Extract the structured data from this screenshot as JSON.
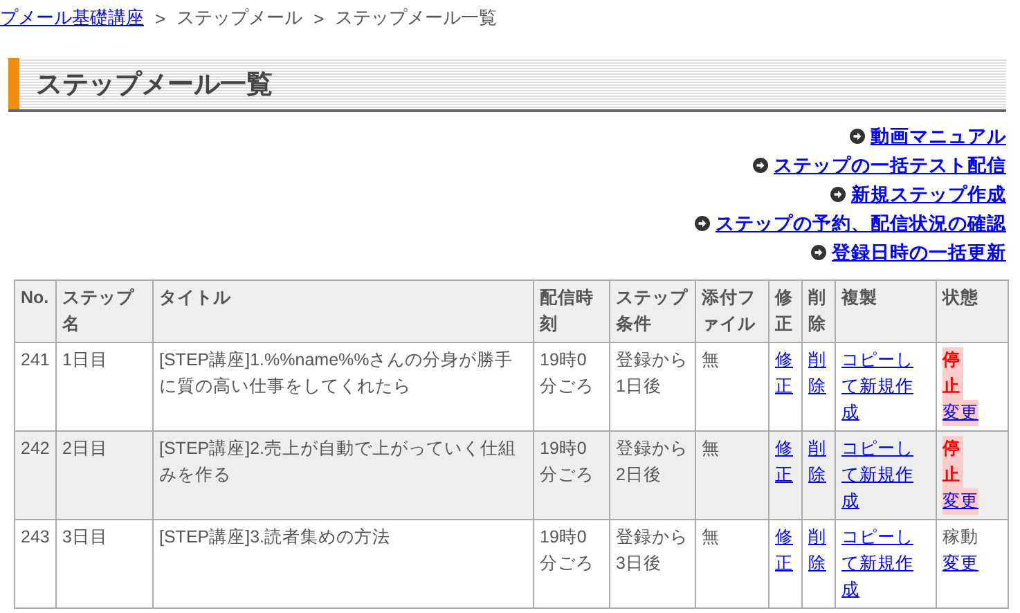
{
  "breadcrumb": [
    {
      "label": "プメール基礎講座",
      "link": true
    },
    {
      "label": "ステップメール",
      "link": false
    },
    {
      "label": "ステップメール一覧",
      "link": false
    }
  ],
  "breadcrumb_separator": ">",
  "heading": "ステップメール一覧",
  "action_links": [
    "動画マニュアル",
    "ステップの一括テスト配信",
    "新規ステップ作成",
    "ステップの予約、配信状況の確認",
    "登録日時の一括更新"
  ],
  "table": {
    "columns": [
      "No.",
      "ステップ名",
      "タイトル",
      "配信時刻",
      "ステップ条件",
      "添付ファイル",
      "修正",
      "削除",
      "複製",
      "状態"
    ],
    "rows": [
      {
        "no": "241",
        "step_name": "1日目",
        "title": "[STEP講座]1.%%name%%さんの分身が勝手に質の高い仕事をしてくれたら",
        "time": "19時0分ごろ",
        "condition": "登録から1日後",
        "attachment": "無",
        "edit": "修正",
        "delete": "削除",
        "copy": "コピーして新規作成",
        "status": "停止",
        "stopped": true,
        "change": "変更"
      },
      {
        "no": "242",
        "step_name": "2日目",
        "title": "[STEP講座]2.売上が自動で上がっていく仕組みを作る",
        "time": "19時0分ごろ",
        "condition": "登録から2日後",
        "attachment": "無",
        "edit": "修正",
        "delete": "削除",
        "copy": "コピーして新規作成",
        "status": "停止",
        "stopped": true,
        "change": "変更"
      },
      {
        "no": "243",
        "step_name": "3日目",
        "title": "[STEP講座]3.読者集めの方法",
        "time": "19時0分ごろ",
        "condition": "登録から3日後",
        "attachment": "無",
        "edit": "修正",
        "delete": "削除",
        "copy": "コピーして新規作成",
        "status": "稼動",
        "stopped": false,
        "change": "変更"
      }
    ]
  }
}
